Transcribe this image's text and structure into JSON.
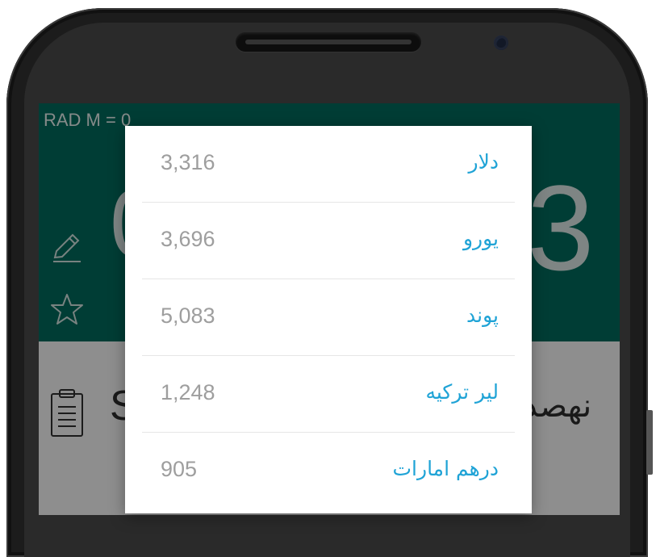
{
  "status": {
    "mode_text": "RAD  M = 0"
  },
  "calculator": {
    "display_left_char": "0",
    "display_right_char": "3",
    "bottom_left_char": "S",
    "bottom_right_text": "نهصد"
  },
  "colors": {
    "header_bg": "#00695c",
    "currency_text": "#1fa3d6",
    "value_text": "#9e9e9e"
  },
  "icons": {
    "edit": "pencil-icon",
    "favorite": "star-icon",
    "history": "clipboard-icon"
  },
  "currency_dialog": {
    "items": [
      {
        "value": "3,316",
        "currency": "دلار"
      },
      {
        "value": "3,696",
        "currency": "یورو"
      },
      {
        "value": "5,083",
        "currency": "پوند"
      },
      {
        "value": "1,248",
        "currency": "لیر ترکیه"
      },
      {
        "value": "905",
        "currency": "درهم امارات"
      }
    ]
  }
}
